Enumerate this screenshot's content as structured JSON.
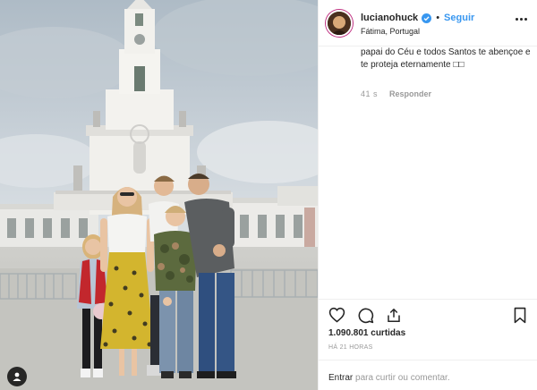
{
  "post": {
    "username": "lucianohuck",
    "follow_label": "Seguir",
    "separator": "•",
    "location": "Fátima, Portugal"
  },
  "comment": {
    "text": "papai do Céu e todos Santos te abençoe e te proteja eternamente □□",
    "time": "41 s",
    "reply_label": "Responder"
  },
  "actions": {
    "likes": "1.090.801 curtidas",
    "timestamp": "HÁ 21 HORAS"
  },
  "login": {
    "link_label": "Entrar",
    "rest": " para curtir ou comentar."
  },
  "colors": {
    "accent": "#3897f0",
    "text": "#262626",
    "muted": "#999999",
    "border": "#efefef"
  },
  "icons": {
    "verified": "verified-badge-icon",
    "more": "more-options-icon",
    "like": "heart-icon",
    "comment": "comment-bubble-icon",
    "share": "share-icon",
    "save": "bookmark-icon",
    "user_tag": "user-tag-icon"
  }
}
